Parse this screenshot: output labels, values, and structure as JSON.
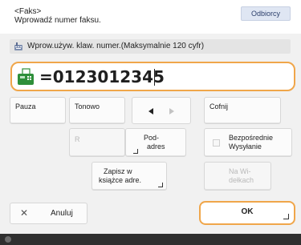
{
  "header": {
    "title": "<Faks>",
    "subtitle": "Wprowadź numer faksu.",
    "recipients_label": "Odbiorcy"
  },
  "prompt": {
    "text": "Wprow.używ. klaw. numer.(Maksymalnie 120 cyfr)",
    "icon": "keyboard-icon"
  },
  "number_field": {
    "icon": "fax-icon",
    "value": "=0123012345"
  },
  "keys": {
    "pause": "Pauza",
    "tone": "Tonowo",
    "backspace": "Cofnij",
    "r": "R",
    "subaddress_line1": "Pod-",
    "subaddress_line2": "adres",
    "direct_send_line1": "Bezpośrednie",
    "direct_send_line2": "Wysyłanie",
    "save_line1": "Zapisz w",
    "save_line2": "książce adre.",
    "hold_line1": "Na Wi-",
    "hold_line2": "dełkach"
  },
  "footer": {
    "cancel_label": "Anuluj",
    "ok_label": "OK"
  },
  "colors": {
    "accent_orange": "#f0a64a",
    "fax_green": "#2e8f3a",
    "panel_bg": "#f1f1f1",
    "status_bar": "#2f2f2f"
  }
}
